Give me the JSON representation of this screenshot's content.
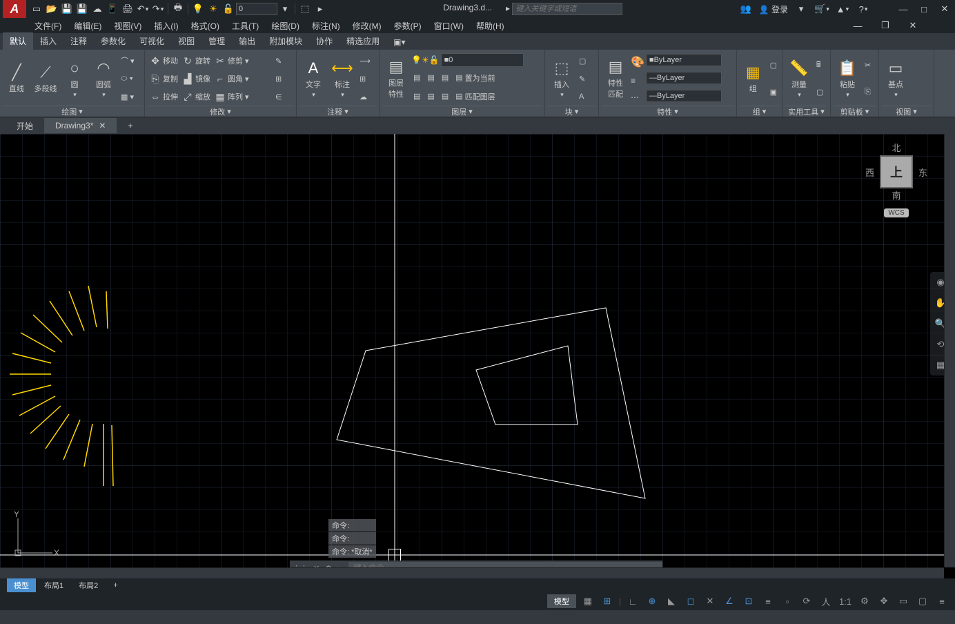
{
  "title": "Drawing3.d...",
  "search_placeholder": "键入关键字或短语",
  "login": "登录",
  "qat_layer_value": "0",
  "menus": [
    "文件(F)",
    "编辑(E)",
    "视图(V)",
    "插入(I)",
    "格式(O)",
    "工具(T)",
    "绘图(D)",
    "标注(N)",
    "修改(M)",
    "参数(P)",
    "窗口(W)",
    "帮助(H)"
  ],
  "ribbon_tabs": [
    "默认",
    "插入",
    "注释",
    "参数化",
    "可视化",
    "视图",
    "管理",
    "输出",
    "附加模块",
    "协作",
    "精选应用"
  ],
  "panels": {
    "draw": {
      "label": "绘图",
      "line": "直线",
      "polyline": "多段线",
      "circle": "圆",
      "arc": "圆弧"
    },
    "modify": {
      "label": "修改",
      "move": "移动",
      "rotate": "旋转",
      "trim": "修剪",
      "copy": "复制",
      "mirror": "镜像",
      "fillet": "圆角",
      "stretch": "拉伸",
      "scale": "缩放",
      "array": "阵列"
    },
    "annot": {
      "label": "注释",
      "text": "文字",
      "dim": "标注"
    },
    "layer": {
      "label": "图层",
      "props": "图层\n特性",
      "current": "0",
      "btn1": "置为当前",
      "btn2": "匹配图层"
    },
    "block": {
      "label": "块",
      "insert": "插入"
    },
    "props": {
      "label": "特性",
      "match": "特性\n匹配",
      "v1": "ByLayer",
      "v2": "ByLayer",
      "v3": "ByLayer"
    },
    "group": {
      "label": "组",
      "g": "组"
    },
    "util": {
      "label": "实用工具",
      "m": "测量"
    },
    "clip": {
      "label": "剪贴板",
      "p": "粘贴"
    },
    "view": {
      "label": "视图",
      "b": "基点"
    }
  },
  "doc_tabs": {
    "start": "开始",
    "drawing": "Drawing3*"
  },
  "viewcube": {
    "n": "北",
    "s": "南",
    "e": "东",
    "w": "西",
    "top": "上",
    "wcs": "WCS"
  },
  "cmd_history": [
    "命令:",
    "命令:",
    "命令: *取消*"
  ],
  "cmd_placeholder": "键入命令",
  "ucs": {
    "x": "X",
    "y": "Y"
  },
  "layout_tabs": [
    "模型",
    "布局1",
    "布局2"
  ],
  "status": {
    "model": "模型",
    "scale": "1:1"
  }
}
